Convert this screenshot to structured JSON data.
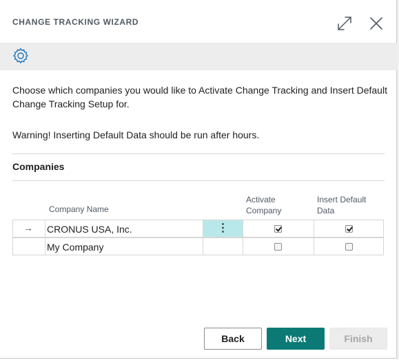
{
  "dialog": {
    "title": "CHANGE TRACKING WIZARD",
    "instructions": "Choose which companies you would like to Activate Change Tracking and Insert Default Change Tracking Setup for.",
    "warning": "Warning! Inserting Default Data should be run after hours."
  },
  "toolbar": {
    "icons": [
      "gear-icon"
    ]
  },
  "companies": {
    "title": "Companies",
    "columns": {
      "company_name": "Company Name",
      "activate_1": "Activate",
      "activate_2": "Company",
      "insert_1": "Insert Default",
      "insert_2": "Data"
    },
    "rows": [
      {
        "name": "CRONUS USA, Inc.",
        "activate": true,
        "insert_default": true,
        "selected": true,
        "marker": "→",
        "actions": "⋮"
      },
      {
        "name": "My Company",
        "activate": false,
        "insert_default": false,
        "selected": false,
        "marker": "",
        "actions": ""
      }
    ]
  },
  "buttons": {
    "back": "Back",
    "next": "Next",
    "finish": "Finish"
  },
  "colors": {
    "accent": "#0b7a75",
    "selection": "#b9e8ea",
    "toolbar_bg": "#ededed"
  }
}
